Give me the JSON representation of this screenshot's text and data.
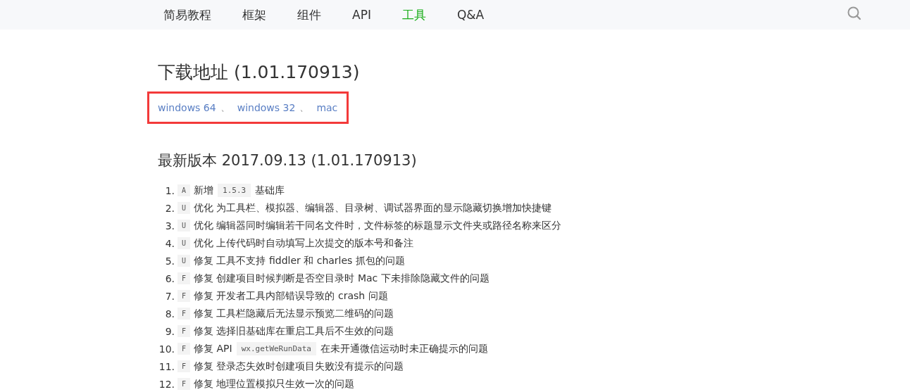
{
  "nav": {
    "items": [
      {
        "label": "简易教程",
        "selected": false
      },
      {
        "label": "框架",
        "selected": false
      },
      {
        "label": "组件",
        "selected": false
      },
      {
        "label": "API",
        "selected": false
      },
      {
        "label": "工具",
        "selected": true
      },
      {
        "label": "Q&A",
        "selected": false
      }
    ]
  },
  "download": {
    "title": "下载地址 (1.01.170913)",
    "links": [
      {
        "label": "windows 64",
        "separator": "、"
      },
      {
        "label": "windows 32",
        "separator": "、"
      },
      {
        "label": "mac"
      }
    ]
  },
  "release": {
    "title": "最新版本 2017.09.13 (1.01.170913)",
    "items": [
      {
        "number": "1.",
        "tag": "A",
        "parts": [
          {
            "kind": "text",
            "text": "新增"
          },
          {
            "kind": "code",
            "text": "1.5.3"
          },
          {
            "kind": "text",
            "text": "基础库"
          }
        ]
      },
      {
        "number": "2.",
        "tag": "U",
        "parts": [
          {
            "kind": "text",
            "text": "优化 为工具栏、模拟器、编辑器、目录树、调试器界面的显示隐藏切换增加快捷键"
          }
        ]
      },
      {
        "number": "3.",
        "tag": "U",
        "parts": [
          {
            "kind": "text",
            "text": "优化 编辑器同时编辑若干同名文件时，文件标签的标题显示文件夹或路径名称来区分"
          }
        ]
      },
      {
        "number": "4.",
        "tag": "U",
        "parts": [
          {
            "kind": "text",
            "text": "优化 上传代码时自动填写上次提交的版本号和备注"
          }
        ]
      },
      {
        "number": "5.",
        "tag": "U",
        "parts": [
          {
            "kind": "text",
            "text": "修复 工具不支持 fiddler 和 charles 抓包的问题"
          }
        ]
      },
      {
        "number": "6.",
        "tag": "F",
        "parts": [
          {
            "kind": "text",
            "text": "修复 创建项目时候判断是否空目录时 Mac 下未排除隐藏文件的问题"
          }
        ]
      },
      {
        "number": "7.",
        "tag": "F",
        "parts": [
          {
            "kind": "text",
            "text": "修复 开发者工具内部错误导致的 crash 问题"
          }
        ]
      },
      {
        "number": "8.",
        "tag": "F",
        "parts": [
          {
            "kind": "text",
            "text": "修复 工具栏隐藏后无法显示预览二维码的问题"
          }
        ]
      },
      {
        "number": "9.",
        "tag": "F",
        "parts": [
          {
            "kind": "text",
            "text": "修复 选择旧基础库在重启工具后不生效的问题"
          }
        ]
      },
      {
        "number": "10.",
        "tag": "F",
        "parts": [
          {
            "kind": "text",
            "text": "修复 API"
          },
          {
            "kind": "code",
            "text": "wx.getWeRunData"
          },
          {
            "kind": "text",
            "text": "在未开通微信运动时未正确提示的问题"
          }
        ]
      },
      {
        "number": "11.",
        "tag": "F",
        "parts": [
          {
            "kind": "text",
            "text": "修复 登录态失效时创建项目失败没有提示的问题"
          }
        ]
      },
      {
        "number": "12.",
        "tag": "F",
        "parts": [
          {
            "kind": "text",
            "text": "修复 地理位置模拟只生效一次的问题"
          }
        ]
      }
    ]
  }
}
